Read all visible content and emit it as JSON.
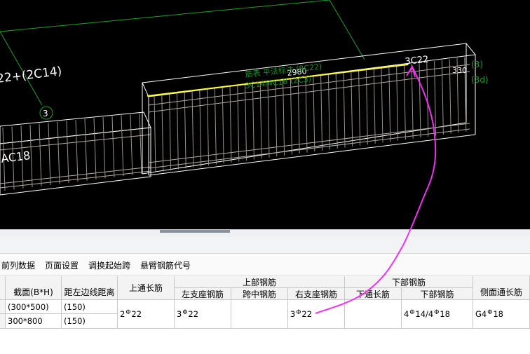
{
  "viewport": {
    "labels": {
      "beam_rebar_note": "22+(2C14)",
      "axis_marker": "3",
      "lower_beam_note": "AC18",
      "span_dim": "2980",
      "right_note_top": "3C22",
      "right_dim": "330",
      "right_green_1": "(3)",
      "right_green_2": "(3d)",
      "green_ann_1": "筋表 平法标注 (8C22)",
      "green_ann_2": "3C14/4C18 (2C3)"
    }
  },
  "toolbar": {
    "items": [
      "前列数据",
      "页面设置",
      "调换起始跨",
      "悬臂钢筋代号"
    ]
  },
  "grid": {
    "headers": {
      "section": "截面(B*H)",
      "distance": "距左边线距离",
      "top_through": "上通长筋",
      "top_group": "上部钢筋",
      "top_left": "左支座钢筋",
      "top_mid": "跨中钢筋",
      "top_right": "右支座钢筋",
      "bottom_group": "下部钢筋",
      "bottom_through": "下通长筋",
      "bottom_rebar": "下部钢筋",
      "side": "侧面通长筋"
    },
    "rows": [
      {
        "section": "(300*500)",
        "distance": "(150)"
      },
      {
        "section": "300*800",
        "distance": "(150)"
      }
    ],
    "merged": {
      "top_through_count": "2",
      "top_through_dia": "22",
      "top_left_count": "3",
      "top_left_dia": "22",
      "top_right_count": "3",
      "top_right_dia": "22",
      "bottom_a_count": "4",
      "bottom_a_dia": "14/4",
      "bottom_b_dia": "18",
      "side_prefix": "G4",
      "side_dia": "18"
    },
    "steel_symbol": "Φ"
  },
  "colors": {
    "cad_bg": "#000000",
    "frame": "#ffffff",
    "rebar": "#b8b0a8",
    "highlight": "#ffff33",
    "green": "#22a02a",
    "annotation_pen": "#ee33ee"
  }
}
